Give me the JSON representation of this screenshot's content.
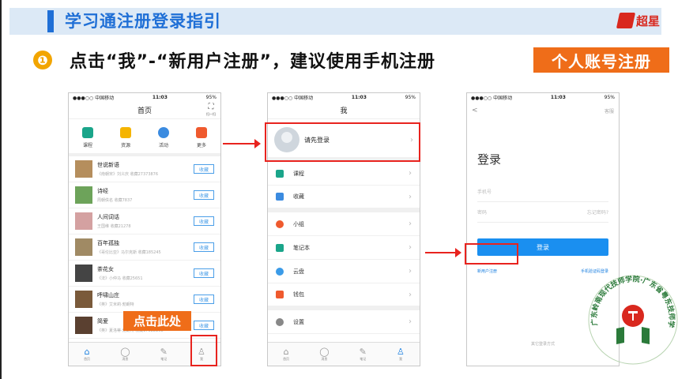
{
  "header": {
    "title": "学习通注册登录指引",
    "logo_text": "超星"
  },
  "step": {
    "number": "❶",
    "text": "点击“我”-“新用户注册”，建议使用手机注册"
  },
  "tag": "个人账号注册",
  "callout": "点击此处",
  "statusbar": {
    "carrier": "●●●○○ 中国移动",
    "time": "11:03",
    "battery": "95%"
  },
  "phone1": {
    "title": "首页",
    "scan_label": "扫一扫",
    "quick": [
      {
        "label": "课程",
        "color": "#1aa58a"
      },
      {
        "label": "资源",
        "color": "#f5b400"
      },
      {
        "label": "活动",
        "color": "#3b8be0"
      },
      {
        "label": "更多",
        "color": "#ef5a2e"
      }
    ],
    "items": [
      {
        "title": "世说新语",
        "sub": "《南朝宋》刘义庆 收藏27373876",
        "fav": "收藏",
        "color": "#b58e5d"
      },
      {
        "title": "诗经",
        "sub": "周朝佚名 收藏7837",
        "fav": "收藏",
        "color": "#6da35a"
      },
      {
        "title": "人间词话",
        "sub": "王国维 收藏21278",
        "fav": "收藏",
        "color": "#d4a1a1"
      },
      {
        "title": "百年孤独",
        "sub": "《哥伦比亚》马尔克斯 收藏185245",
        "fav": "收藏",
        "color": "#a08a64"
      },
      {
        "title": "茶花女",
        "sub": "《法》小仲马 收藏25651",
        "fav": "收藏",
        "color": "#444"
      },
      {
        "title": "呼啸山庄",
        "sub": "《英》艾米莉·勃朗特",
        "fav": "收藏",
        "color": "#7a5a3a"
      },
      {
        "title": "简爱",
        "sub": "《英》夏洛蒂·勃朗特 收藏17322208",
        "fav": "收藏",
        "color": "#5a4030"
      }
    ],
    "tabs": [
      "首页",
      "消息",
      "笔记",
      "我"
    ]
  },
  "phone2": {
    "title": "我",
    "login_prompt": "请先登录",
    "rows": [
      {
        "label": "课程",
        "color": "#1aa58a"
      },
      {
        "label": "收藏",
        "color": "#3b8be0"
      },
      {
        "label": "小组",
        "color": "#ef5a2e"
      },
      {
        "label": "笔记本",
        "color": "#1aa58a"
      },
      {
        "label": "云盘",
        "color": "#3b9be8"
      },
      {
        "label": "钱包",
        "color": "#ef5a2e"
      },
      {
        "label": "设置",
        "color": "#888"
      }
    ],
    "tabs": [
      "首页",
      "消息",
      "笔记",
      "我"
    ]
  },
  "phone3": {
    "back": "<",
    "help": "客服",
    "heading": "登录",
    "phone_ph": "手机号",
    "pwd_ph": "密码",
    "forgot": "忘记密码?",
    "login_btn": "登录",
    "register": "新用户注册",
    "sms_login": "手机验证码登录",
    "other": "其它登录方式"
  },
  "seal": {
    "text": "广东岭南现代技师学院·广东省粤东技师学院"
  }
}
